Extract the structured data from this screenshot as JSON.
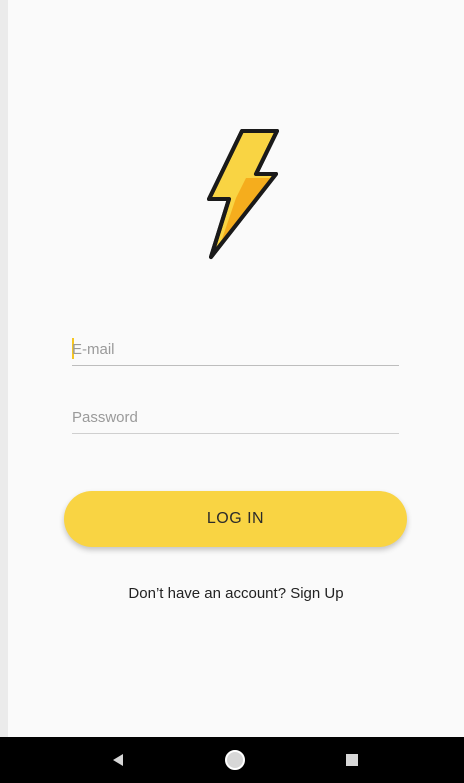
{
  "logo": {
    "icon": "lightning-bolt-icon",
    "color": "#f9d443",
    "accent": "#f4b51d"
  },
  "form": {
    "email": {
      "placeholder": "E-mail",
      "value": ""
    },
    "password": {
      "placeholder": "Password",
      "value": ""
    }
  },
  "login": {
    "label": "LOG IN",
    "color": "#f9d443"
  },
  "signup": {
    "text": "Don’t have an account? Sign Up"
  },
  "navbar": {
    "back_icon": "back-triangle-icon",
    "home_icon": "home-circle-icon",
    "recents_icon": "recents-square-icon"
  }
}
